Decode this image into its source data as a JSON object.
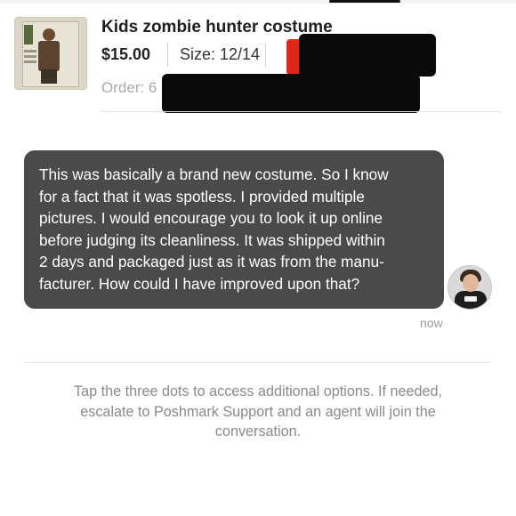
{
  "listing": {
    "title": "Kids zombie hunter costume",
    "price": "$15.00",
    "size": "Size: 12/14",
    "order_label": "Order: 6"
  },
  "message": {
    "lines": [
      "This was basically a brand new costume. So I know",
      "for a fact that it was spotless. I provided multiple",
      "pictures. I would encourage you to look it up online",
      "before judging its cleanliness. It was shipped within",
      "2 days and packaged just as it was from the manu-",
      "facturer. How could I have improved upon that?"
    ],
    "timestamp": "now"
  },
  "hint": {
    "lines": [
      "Tap the three dots to access additional options. If needed,",
      "escalate to Poshmark Support and an agent will join the",
      "conversation."
    ]
  },
  "colors": {
    "bubble": "#4a4a4a",
    "redaction": "#0a0a0a",
    "redaction_accent": "#e0281a"
  },
  "icons": {
    "listing_thumbnail": "costume-package-photo",
    "sender_avatar": "user-avatar"
  }
}
